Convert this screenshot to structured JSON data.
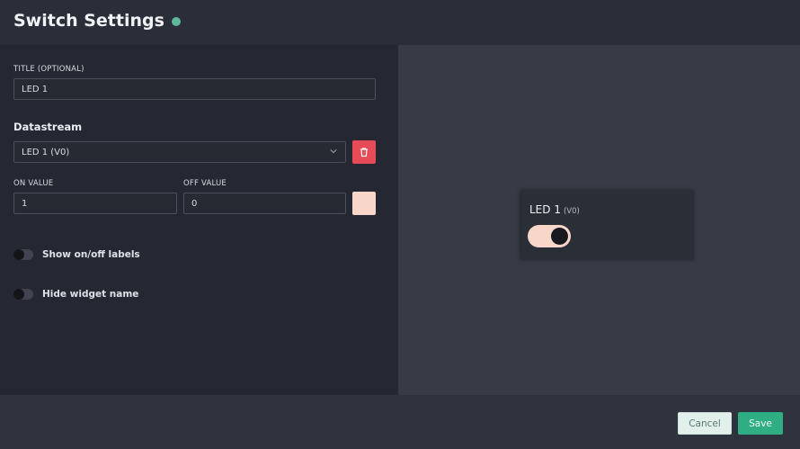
{
  "header": {
    "title": "Switch Settings"
  },
  "form": {
    "title_label": "TITLE (OPTIONAL)",
    "title_value": "LED 1",
    "datastream_label": "Datastream",
    "datastream_value": "LED 1 (V0)",
    "on_value_label": "ON VALUE",
    "on_value": "1",
    "off_value_label": "OFF VALUE",
    "off_value": "0",
    "on_color": "#f8d7ca",
    "toggles": [
      {
        "label": "Show on/off labels",
        "on": false
      },
      {
        "label": "Hide widget name",
        "on": false
      }
    ]
  },
  "preview": {
    "widget_title": "LED 1",
    "widget_pin": "(V0)",
    "switch_on": true
  },
  "footer": {
    "cancel_label": "Cancel",
    "save_label": "Save"
  },
  "colors": {
    "accent": "#2fae83",
    "delete": "#e64c57"
  }
}
